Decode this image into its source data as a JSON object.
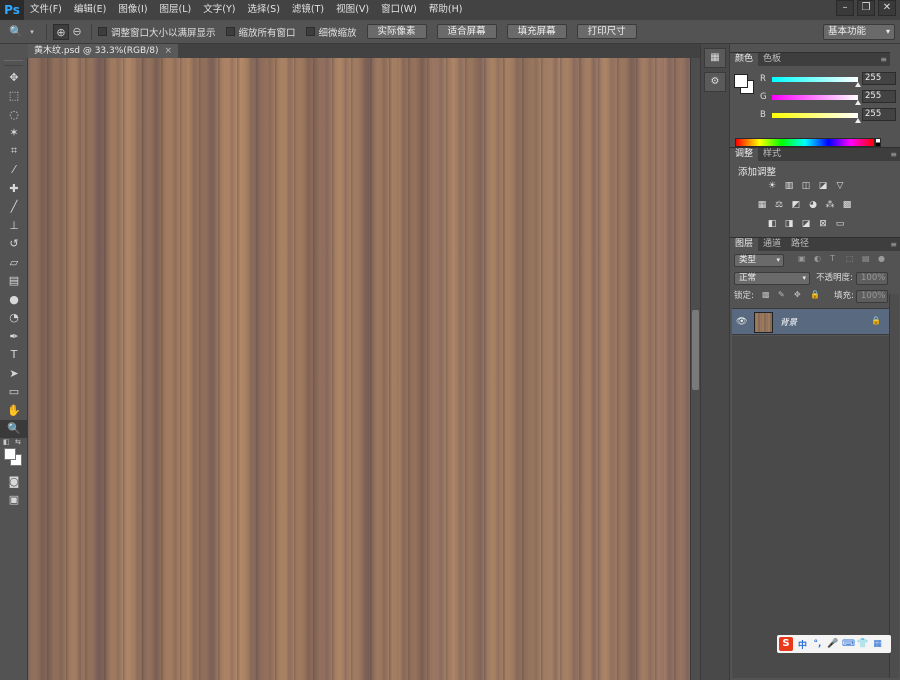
{
  "app": {
    "logo": "Ps"
  },
  "menu": [
    "文件(F)",
    "编辑(E)",
    "图像(I)",
    "图层(L)",
    "文字(Y)",
    "选择(S)",
    "滤镜(T)",
    "视图(V)",
    "窗口(W)",
    "帮助(H)"
  ],
  "window_controls": {
    "minimize": "–",
    "restore": "❐",
    "close": "✕"
  },
  "options_bar": {
    "resize_windows_label": "调整窗口大小以满屏显示",
    "zoom_all_label": "缩放所有窗口",
    "scrubby_zoom_label": "细微缩放",
    "actual_pixels": "实际像素",
    "fit_screen": "适合屏幕",
    "fill_screen": "填充屏幕",
    "print_size": "打印尺寸",
    "workspace": "基本功能"
  },
  "document": {
    "tab_title": "黄木纹.psd @ 33.3%(RGB/8)",
    "close_glyph": "×"
  },
  "color_panel": {
    "tabs": [
      "颜色",
      "色板"
    ],
    "channels": [
      {
        "label": "R",
        "value": "255",
        "color": "#ff0000"
      },
      {
        "label": "G",
        "value": "255",
        "color": "#00ff00"
      },
      {
        "label": "B",
        "value": "255",
        "color": "#0000ff"
      }
    ]
  },
  "adjustments_panel": {
    "tabs": [
      "调整",
      "样式"
    ],
    "title": "添加调整"
  },
  "layers_panel": {
    "tabs": [
      "图层",
      "通道",
      "路径"
    ],
    "filter_kind": "类型",
    "blend_mode": "正常",
    "opacity_label": "不透明度:",
    "opacity_value": "100%",
    "lock_label": "锁定:",
    "fill_label": "填充:",
    "fill_value": "100%",
    "layers": [
      {
        "name": "背景",
        "visible": true,
        "locked": true
      }
    ]
  },
  "ime_bar": {
    "logo": "S",
    "mode": "中"
  },
  "colors": {
    "accent_blue": "#31a8ff",
    "layer_selected": "#596a80",
    "ui_gray": "#535353"
  }
}
